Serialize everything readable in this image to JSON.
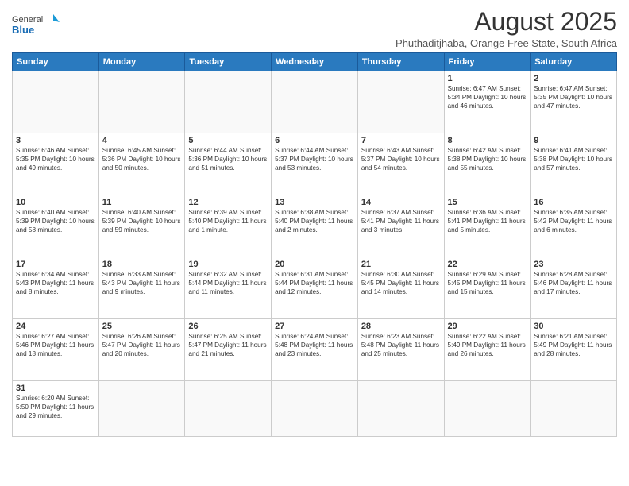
{
  "title": "August 2025",
  "subtitle": "Phuthaditjhaba, Orange Free State, South Africa",
  "logo": {
    "general": "General",
    "blue": "Blue"
  },
  "days_of_week": [
    "Sunday",
    "Monday",
    "Tuesday",
    "Wednesday",
    "Thursday",
    "Friday",
    "Saturday"
  ],
  "weeks": [
    [
      {
        "day": "",
        "info": ""
      },
      {
        "day": "",
        "info": ""
      },
      {
        "day": "",
        "info": ""
      },
      {
        "day": "",
        "info": ""
      },
      {
        "day": "",
        "info": ""
      },
      {
        "day": "1",
        "info": "Sunrise: 6:47 AM\nSunset: 5:34 PM\nDaylight: 10 hours and 46 minutes."
      },
      {
        "day": "2",
        "info": "Sunrise: 6:47 AM\nSunset: 5:35 PM\nDaylight: 10 hours and 47 minutes."
      }
    ],
    [
      {
        "day": "3",
        "info": "Sunrise: 6:46 AM\nSunset: 5:35 PM\nDaylight: 10 hours and 49 minutes."
      },
      {
        "day": "4",
        "info": "Sunrise: 6:45 AM\nSunset: 5:36 PM\nDaylight: 10 hours and 50 minutes."
      },
      {
        "day": "5",
        "info": "Sunrise: 6:44 AM\nSunset: 5:36 PM\nDaylight: 10 hours and 51 minutes."
      },
      {
        "day": "6",
        "info": "Sunrise: 6:44 AM\nSunset: 5:37 PM\nDaylight: 10 hours and 53 minutes."
      },
      {
        "day": "7",
        "info": "Sunrise: 6:43 AM\nSunset: 5:37 PM\nDaylight: 10 hours and 54 minutes."
      },
      {
        "day": "8",
        "info": "Sunrise: 6:42 AM\nSunset: 5:38 PM\nDaylight: 10 hours and 55 minutes."
      },
      {
        "day": "9",
        "info": "Sunrise: 6:41 AM\nSunset: 5:38 PM\nDaylight: 10 hours and 57 minutes."
      }
    ],
    [
      {
        "day": "10",
        "info": "Sunrise: 6:40 AM\nSunset: 5:39 PM\nDaylight: 10 hours and 58 minutes."
      },
      {
        "day": "11",
        "info": "Sunrise: 6:40 AM\nSunset: 5:39 PM\nDaylight: 10 hours and 59 minutes."
      },
      {
        "day": "12",
        "info": "Sunrise: 6:39 AM\nSunset: 5:40 PM\nDaylight: 11 hours and 1 minute."
      },
      {
        "day": "13",
        "info": "Sunrise: 6:38 AM\nSunset: 5:40 PM\nDaylight: 11 hours and 2 minutes."
      },
      {
        "day": "14",
        "info": "Sunrise: 6:37 AM\nSunset: 5:41 PM\nDaylight: 11 hours and 3 minutes."
      },
      {
        "day": "15",
        "info": "Sunrise: 6:36 AM\nSunset: 5:41 PM\nDaylight: 11 hours and 5 minutes."
      },
      {
        "day": "16",
        "info": "Sunrise: 6:35 AM\nSunset: 5:42 PM\nDaylight: 11 hours and 6 minutes."
      }
    ],
    [
      {
        "day": "17",
        "info": "Sunrise: 6:34 AM\nSunset: 5:43 PM\nDaylight: 11 hours and 8 minutes."
      },
      {
        "day": "18",
        "info": "Sunrise: 6:33 AM\nSunset: 5:43 PM\nDaylight: 11 hours and 9 minutes."
      },
      {
        "day": "19",
        "info": "Sunrise: 6:32 AM\nSunset: 5:44 PM\nDaylight: 11 hours and 11 minutes."
      },
      {
        "day": "20",
        "info": "Sunrise: 6:31 AM\nSunset: 5:44 PM\nDaylight: 11 hours and 12 minutes."
      },
      {
        "day": "21",
        "info": "Sunrise: 6:30 AM\nSunset: 5:45 PM\nDaylight: 11 hours and 14 minutes."
      },
      {
        "day": "22",
        "info": "Sunrise: 6:29 AM\nSunset: 5:45 PM\nDaylight: 11 hours and 15 minutes."
      },
      {
        "day": "23",
        "info": "Sunrise: 6:28 AM\nSunset: 5:46 PM\nDaylight: 11 hours and 17 minutes."
      }
    ],
    [
      {
        "day": "24",
        "info": "Sunrise: 6:27 AM\nSunset: 5:46 PM\nDaylight: 11 hours and 18 minutes."
      },
      {
        "day": "25",
        "info": "Sunrise: 6:26 AM\nSunset: 5:47 PM\nDaylight: 11 hours and 20 minutes."
      },
      {
        "day": "26",
        "info": "Sunrise: 6:25 AM\nSunset: 5:47 PM\nDaylight: 11 hours and 21 minutes."
      },
      {
        "day": "27",
        "info": "Sunrise: 6:24 AM\nSunset: 5:48 PM\nDaylight: 11 hours and 23 minutes."
      },
      {
        "day": "28",
        "info": "Sunrise: 6:23 AM\nSunset: 5:48 PM\nDaylight: 11 hours and 25 minutes."
      },
      {
        "day": "29",
        "info": "Sunrise: 6:22 AM\nSunset: 5:49 PM\nDaylight: 11 hours and 26 minutes."
      },
      {
        "day": "30",
        "info": "Sunrise: 6:21 AM\nSunset: 5:49 PM\nDaylight: 11 hours and 28 minutes."
      }
    ],
    [
      {
        "day": "31",
        "info": "Sunrise: 6:20 AM\nSunset: 5:50 PM\nDaylight: 11 hours and 29 minutes."
      },
      {
        "day": "",
        "info": ""
      },
      {
        "day": "",
        "info": ""
      },
      {
        "day": "",
        "info": ""
      },
      {
        "day": "",
        "info": ""
      },
      {
        "day": "",
        "info": ""
      },
      {
        "day": "",
        "info": ""
      }
    ]
  ]
}
